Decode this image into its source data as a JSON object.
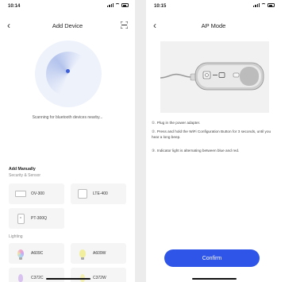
{
  "colors": {
    "accent": "#2e54e8",
    "card_bg": "#f5f5f5",
    "screen_bg": "#ffffff"
  },
  "left_screen": {
    "status_time": "10:14",
    "title": "Add Device",
    "scan_text": "Scanning for bluetooth devices nearby...",
    "manual": {
      "heading": "Add Manually",
      "category_security": "Security & Sensor",
      "security_devices": [
        {
          "label": "OV-300",
          "icon": "outdoor-camera-icon"
        },
        {
          "label": "LTE-400",
          "icon": "hub-icon"
        },
        {
          "label": "PT-300Q",
          "icon": "sensor-icon"
        }
      ],
      "category_lighting": "Lighting",
      "lighting_devices": [
        {
          "label": "A609C",
          "icon": "color-bulb-icon",
          "color": "#c9a6f2"
        },
        {
          "label": "A609W",
          "icon": "white-bulb-icon",
          "color": "#f1ee9e"
        },
        {
          "label": "C372C",
          "icon": "candle-bulb-icon",
          "color": "#d9c1f0"
        },
        {
          "label": "C372W",
          "icon": "white-candle-bulb-icon",
          "color": "#f2efb0"
        }
      ]
    }
  },
  "right_screen": {
    "status_time": "10:15",
    "title": "AP Mode",
    "instructions": [
      "①. Plug in the power adapter.",
      "②. Press and hold the WiFi Configuration Button for 3 seconds, until you hear a long beep.",
      "③. Indicator light is alternating between blue and red."
    ],
    "confirm_label": "Confirm"
  }
}
